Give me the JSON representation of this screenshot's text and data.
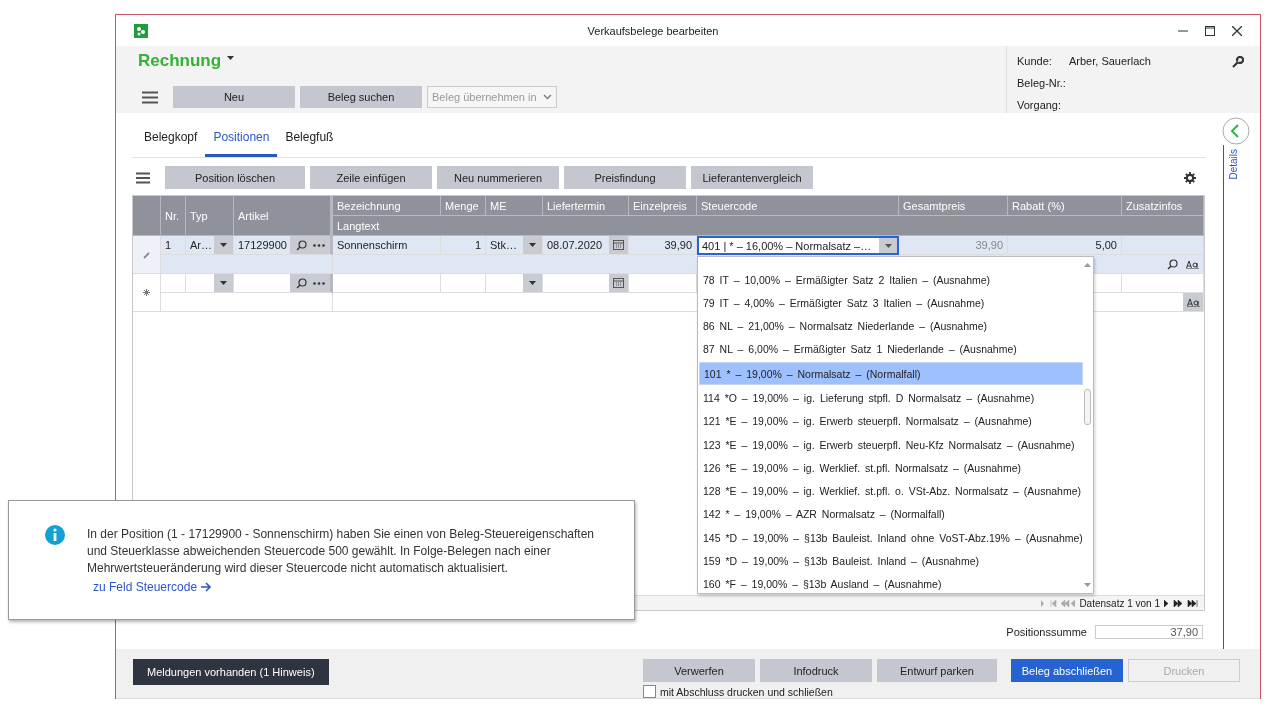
{
  "window": {
    "title": "Verkaufsbelege bearbeiten"
  },
  "document_type": "Rechnung",
  "toolbar": {
    "buttons": [
      {
        "label": "Neu",
        "disabled": false
      },
      {
        "label": "Beleg suchen",
        "disabled": false
      }
    ],
    "transfer_dropdown": {
      "label": "Beleg übernehmen in",
      "disabled": true
    }
  },
  "info": [
    {
      "label": "Kunde:",
      "value": "Arber, Sauerlach"
    },
    {
      "label": "Beleg-Nr.:"
    },
    {
      "label": "Vorgang:"
    }
  ],
  "side_panel": {
    "label": "Details"
  },
  "tabs": [
    {
      "label": "Belegkopf",
      "selected": false
    },
    {
      "label": "Positionen",
      "selected": true
    },
    {
      "label": "Belegfuß",
      "selected": false
    }
  ],
  "grid_toolbar": [
    "Position löschen",
    "Zeile einfügen",
    "Neu nummerieren",
    "Preisfindung",
    "Lieferantenvergleich"
  ],
  "table": {
    "columns": [
      "Nr.",
      "Typ",
      "Artikel",
      "Bezeichnung",
      "Menge",
      "ME",
      "Liefertermin",
      "Einzelpreis",
      "Steuercode",
      "Gesamtpreis",
      "Rabatt (%)",
      "Zusatzinfos"
    ],
    "subheader": "Langtext",
    "rows": [
      {
        "nr": "1",
        "typ": "Ar…",
        "artikel": "17129900",
        "bezeichnung": "Sonnenschirm",
        "menge": "1",
        "me": "Stk…",
        "liefertermin": "08.07.2020",
        "einzelpreis": "39,90",
        "steuercode": "401 | * – 16,00% – Normalsatz –…",
        "gesamtpreis": "39,90",
        "rabatt": "5,00",
        "selected": true
      }
    ],
    "navigator": "Datensatz 1 von 1"
  },
  "tax_dropdown": {
    "items": [
      {
        "text": "78  IT – 10,00% – Ermäßigter Satz 2 Italien – (Ausnahme)",
        "selected": false
      },
      {
        "text": "79  IT – 4,00% – Ermäßigter Satz 3 Italien – (Ausnahme)",
        "selected": false
      },
      {
        "text": "86  NL – 21,00% – Normalsatz Niederlande – (Ausnahme)",
        "selected": false
      },
      {
        "text": "87  NL – 6,00% – Ermäßigter Satz 1 Niederlande – (Ausnahme)",
        "selected": false
      },
      {
        "text": "101 * – 19,00% – Normalsatz – (Normalfall)",
        "selected": true
      },
      {
        "text": "114 *O – 19,00% – ig. Lieferung stpfl. D Normalsatz – (Ausnahme)",
        "selected": false
      },
      {
        "text": "121 *E – 19,00% – ig. Erwerb steuerpfl. Normalsatz – (Ausnahme)",
        "selected": false
      },
      {
        "text": "123 *E – 19,00% – ig. Erwerb steuerpfl. Neu-Kfz Normalsatz – (Ausnahme)",
        "selected": false
      },
      {
        "text": "126 *E – 19,00% – ig. Werklief. st.pfl. Normalsatz – (Ausnahme)",
        "selected": false
      },
      {
        "text": "128 *E – 19,00% – ig. Werklief. st.pfl. o. VSt-Abz. Normalsatz – (Ausnahme)",
        "selected": false
      },
      {
        "text": "142 * – 19,00% – AZR Normalsatz – (Normalfall)",
        "selected": false
      },
      {
        "text": "145 *D – 19,00% – §13b Bauleist. Inland ohne VoST-Abz.19% – (Ausnahme)",
        "selected": false
      },
      {
        "text": "159 *D – 19,00% – §13b Bauleist. Inland – (Ausnahme)",
        "selected": false
      },
      {
        "text": "160 *F – 19,00% – §13b Ausland – (Ausnahme)",
        "selected": false
      }
    ]
  },
  "position_sum": {
    "label": "Positionssumme",
    "value": "37,90"
  },
  "footer": {
    "messages_button": "Meldungen vorhanden (1 Hinweis)",
    "buttons": [
      {
        "label": "Verwerfen",
        "kind": "secondary",
        "disabled": false
      },
      {
        "label": "Infodruck",
        "kind": "secondary",
        "disabled": false
      },
      {
        "label": "Entwurf parken",
        "kind": "secondary",
        "disabled": false
      },
      {
        "label": "Beleg abschließen",
        "kind": "primary",
        "disabled": false
      },
      {
        "label": "Drucken",
        "kind": "secondary",
        "disabled": true
      }
    ],
    "checkbox": {
      "label": "mit Abschluss drucken und schließen",
      "checked": false
    }
  },
  "notification": {
    "text": "In der Position (1 - 17129900 - Sonnenschirm) haben Sie einen von Beleg-Steuereigenschaften und Steuerklasse abweichenden Steuercode 500 gewählt. In Folge-Belegen nach einer Mehrwertsteueränderung wird dieser Steuercode nicht automatisch aktualisiert.",
    "link": "zu Feld Steuercode"
  }
}
